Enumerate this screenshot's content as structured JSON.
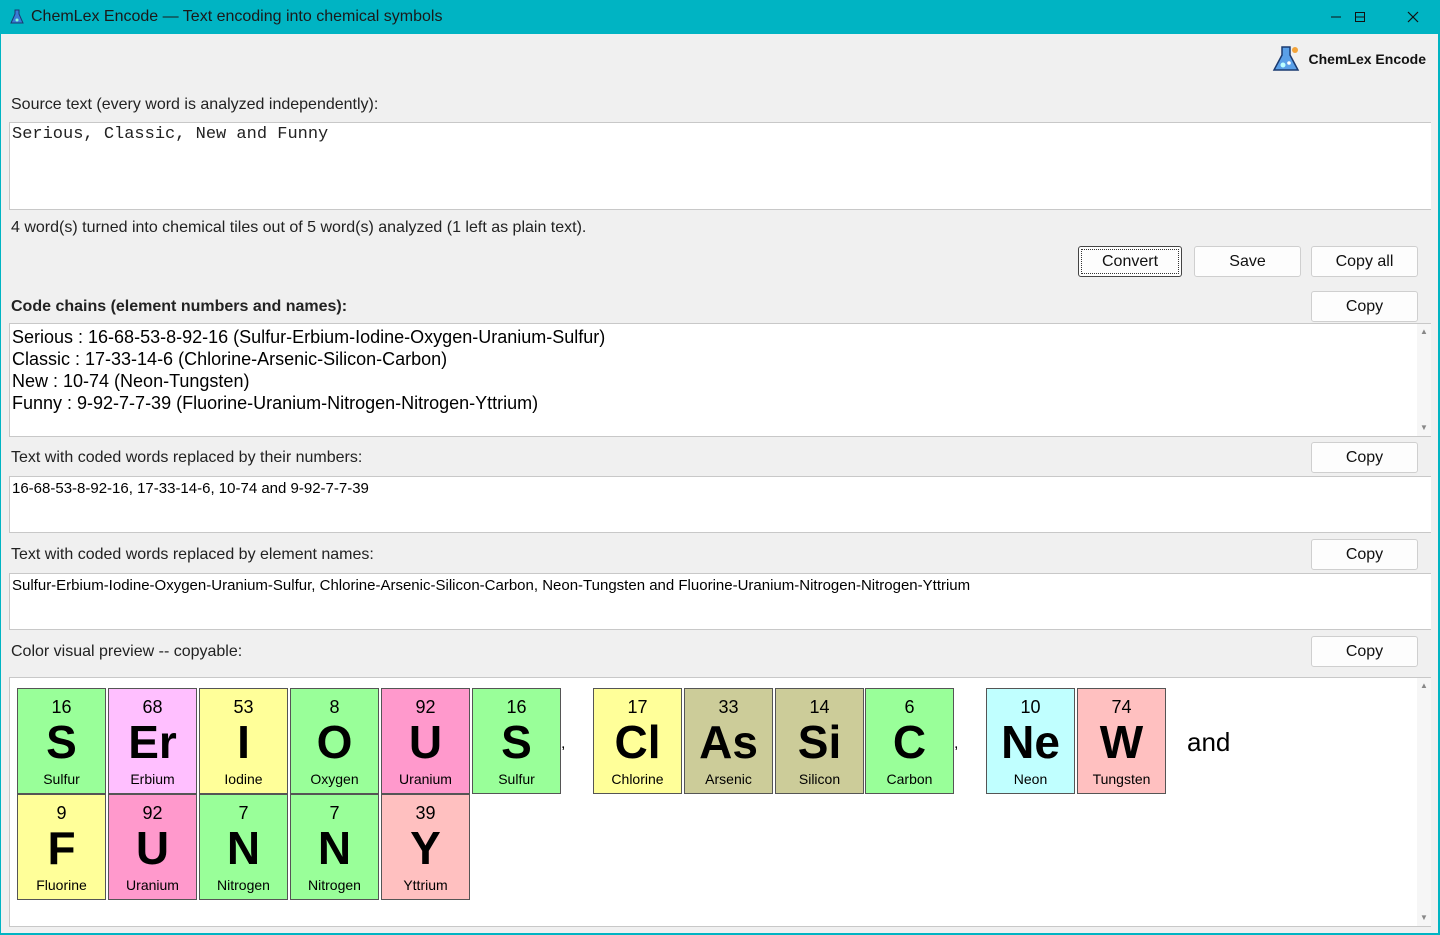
{
  "window": {
    "title": "ChemLex Encode — Text encoding into chemical symbols",
    "minimize_icon": "minimize-icon",
    "maximize_icon": "maximize-icon",
    "close_icon": "close-icon"
  },
  "brand": {
    "name": "ChemLex Encode",
    "icon": "flask-icon"
  },
  "source": {
    "label": "Source text (every word is analyzed independently):",
    "value": "Serious, Classic, New and Funny"
  },
  "status": "4 word(s) turned into chemical tiles out of 5 word(s) analyzed (1 left as plain text).",
  "buttons": {
    "convert": "Convert",
    "save": "Save",
    "copy_all": "Copy all",
    "copy": "Copy"
  },
  "chains": {
    "label": "Code chains (element numbers and names):",
    "lines": [
      "Serious : 16-68-53-8-92-16  (Sulfur-Erbium-Iodine-Oxygen-Uranium-Sulfur)",
      "Classic : 17-33-14-6  (Chlorine-Arsenic-Silicon-Carbon)",
      "New : 10-74  (Neon-Tungsten)",
      "Funny : 9-92-7-7-39  (Fluorine-Uranium-Nitrogen-Nitrogen-Yttrium)"
    ]
  },
  "numbers_text": {
    "label": "Text with coded words replaced by their numbers:",
    "value": "16-68-53-8-92-16, 17-33-14-6, 10-74 and 9-92-7-7-39"
  },
  "names_text": {
    "label": "Text with coded words replaced by element names:",
    "value": "Sulfur-Erbium-Iodine-Oxygen-Uranium-Sulfur, Chlorine-Arsenic-Silicon-Carbon, Neon-Tungsten and Fluorine-Uranium-Nitrogen-Nitrogen-Yttrium"
  },
  "preview": {
    "label": "Color visual preview -- copyable:",
    "tiles": [
      {
        "num": "16",
        "sym": "S",
        "name": "Sulfur",
        "color": "#99ff99"
      },
      {
        "num": "68",
        "sym": "Er",
        "name": "Erbium",
        "color": "#ffbfff"
      },
      {
        "num": "53",
        "sym": "I",
        "name": "Iodine",
        "color": "#ffff99"
      },
      {
        "num": "8",
        "sym": "O",
        "name": "Oxygen",
        "color": "#99ff99"
      },
      {
        "num": "92",
        "sym": "U",
        "name": "Uranium",
        "color": "#ff99cc"
      },
      {
        "num": "16",
        "sym": "S",
        "name": "Sulfur",
        "color": "#99ff99"
      },
      {
        "num": "17",
        "sym": "Cl",
        "name": "Chlorine",
        "color": "#ffff99"
      },
      {
        "num": "33",
        "sym": "As",
        "name": "Arsenic",
        "color": "#cccc99"
      },
      {
        "num": "14",
        "sym": "Si",
        "name": "Silicon",
        "color": "#cccc99"
      },
      {
        "num": "6",
        "sym": "C",
        "name": "Carbon",
        "color": "#99ff99"
      },
      {
        "num": "10",
        "sym": "Ne",
        "name": "Neon",
        "color": "#c0ffff"
      },
      {
        "num": "74",
        "sym": "W",
        "name": "Tungsten",
        "color": "#ffc0c0"
      },
      {
        "num": "9",
        "sym": "F",
        "name": "Fluorine",
        "color": "#ffff99"
      },
      {
        "num": "92",
        "sym": "U",
        "name": "Uranium",
        "color": "#ff99cc"
      },
      {
        "num": "7",
        "sym": "N",
        "name": "Nitrogen",
        "color": "#99ff99"
      },
      {
        "num": "7",
        "sym": "N",
        "name": "Nitrogen",
        "color": "#99ff99"
      },
      {
        "num": "39",
        "sym": "Y",
        "name": "Yttrium",
        "color": "#ffc0c0"
      }
    ],
    "separators": [
      ",",
      ",",
      "and"
    ]
  }
}
